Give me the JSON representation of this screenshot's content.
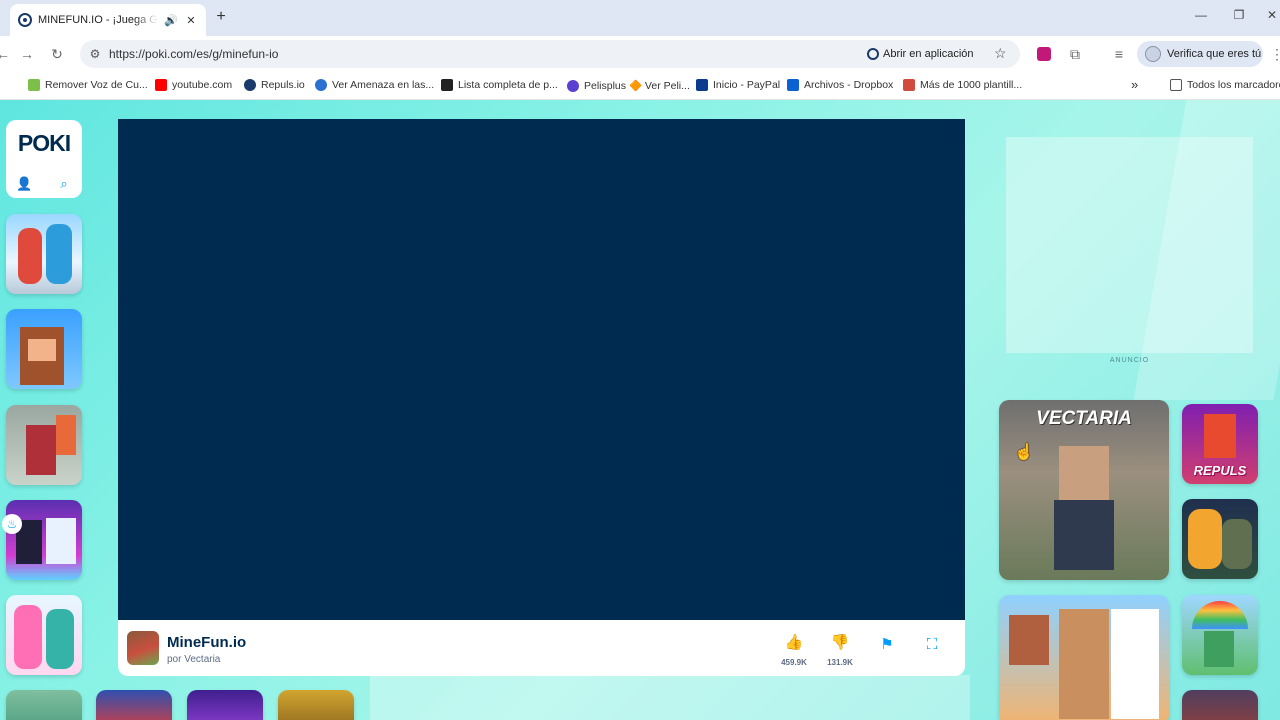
{
  "browser": {
    "tab": {
      "title": "MINEFUN.IO - ¡Juega Gratis",
      "audio_icon": "🔊",
      "close_icon": "✕"
    },
    "new_tab_icon": "+",
    "window": {
      "minimize": "—",
      "restore": "❐",
      "close": "✕"
    },
    "nav": {
      "back": "←",
      "forward": "→",
      "reload": "↻",
      "site_info": "⚙"
    },
    "url": "https://poki.com/es/g/minefun-io",
    "open_in_app": "Abrir en aplicación",
    "bookmark_star": "☆",
    "profile_label": "Verifica que eres tú",
    "menu_icon": "⋮",
    "extensions": {
      "cast": "≡",
      "puzzle": "⧉"
    }
  },
  "bookmarks": [
    {
      "label": "Remover Voz de Cu...",
      "color": "#7cc04b"
    },
    {
      "label": "youtube.com",
      "color": "#ff0000"
    },
    {
      "label": "Repuls.io",
      "color": "#1a3a6b"
    },
    {
      "label": "Ver Amenaza en las...",
      "color": "#2a6fd1"
    },
    {
      "label": "Lista completa de p...",
      "color": "#222222"
    },
    {
      "label": "Pelisplus 🔶 Ver Peli...",
      "color": "#5b3fd1"
    },
    {
      "label": "Inicio - PayPal",
      "color": "#0a3b8c"
    },
    {
      "label": "Archivos - Dropbox",
      "color": "#0a61d1"
    },
    {
      "label": "Más de 1000 plantill...",
      "color": "#d14b3f"
    }
  ],
  "bookmarks_more": "»",
  "all_bookmarks": "Todos los marcadores",
  "site": {
    "logo": "POKI",
    "user_icon": "👤",
    "search_icon": "⌕"
  },
  "game": {
    "name": "MineFun.io",
    "developer": "por Vectaria",
    "likes": "459.9K",
    "dislikes": "131.9K",
    "like_icon": "👍",
    "dislike_icon": "👎",
    "report_icon": "⚑",
    "fullscreen_icon": "⛶"
  },
  "ad_label": "ANUNCIO",
  "featured": {
    "title": "VECTARIA"
  },
  "repuls_thumb": {
    "title": "REPULS"
  },
  "trending_badge_icon": "♨",
  "cursor_icon": "☝"
}
